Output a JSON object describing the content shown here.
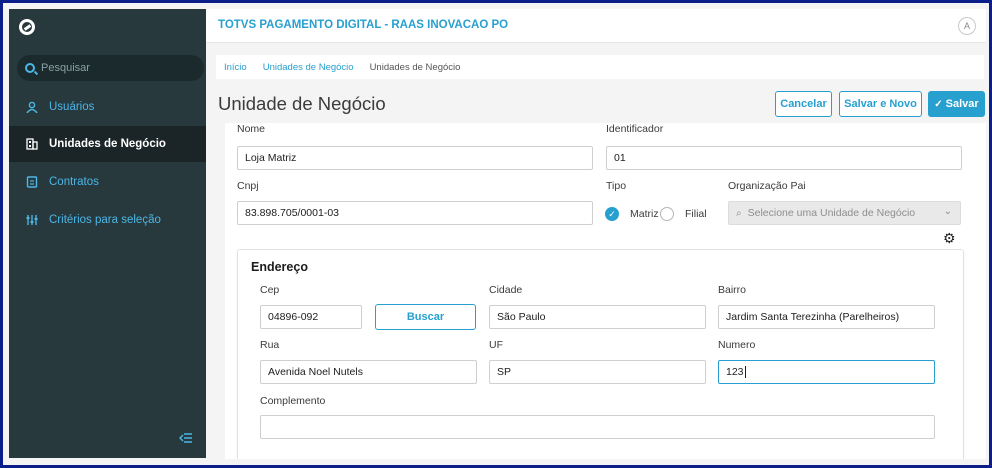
{
  "app": {
    "title": "TOTVS PAGAMENTO DIGITAL - RAAS INOVACAO PO",
    "avatar_letter": "A"
  },
  "sidebar": {
    "search_placeholder": "Pesquisar",
    "items": [
      {
        "label": "Usuários",
        "icon": "user-icon"
      },
      {
        "label": "Unidades de Negócio",
        "icon": "building-icon",
        "active": true
      },
      {
        "label": "Contratos",
        "icon": "contract-icon"
      },
      {
        "label": "Critérios para seleção",
        "icon": "sliders-icon"
      }
    ]
  },
  "breadcrumb": [
    "Início",
    "Unidades de Negócio",
    "Unidades de Negócio"
  ],
  "page": {
    "title": "Unidade de Negócio"
  },
  "actions": {
    "cancel": "Cancelar",
    "save_new": "Salvar e Novo",
    "save": "Salvar",
    "save_icon": "check-icon"
  },
  "form": {
    "nome": {
      "label": "Nome",
      "value": "Loja Matriz"
    },
    "identificador": {
      "label": "Identificador",
      "value": "01"
    },
    "cnpj": {
      "label": "Cnpj",
      "value": "83.898.705/0001-03"
    },
    "tipo": {
      "label": "Tipo",
      "options": [
        "Matriz",
        "Filial"
      ],
      "selected": "Matriz"
    },
    "organizacao_pai": {
      "label": "Organização Pai",
      "placeholder": "Selecione uma Unidade de Negócio"
    }
  },
  "endereco": {
    "title": "Endereço",
    "cep": {
      "label": "Cep",
      "value": "04896-092"
    },
    "buscar": "Buscar",
    "cidade": {
      "label": "Cidade",
      "value": "São Paulo"
    },
    "bairro": {
      "label": "Bairro",
      "value": "Jardim Santa Terezinha (Parelheiros)"
    },
    "rua": {
      "label": "Rua",
      "value": "Avenida Noel Nutels"
    },
    "uf": {
      "label": "UF",
      "value": "SP"
    },
    "numero": {
      "label": "Numero",
      "value": "123"
    },
    "complemento": {
      "label": "Complemento",
      "value": ""
    }
  },
  "colors": {
    "accent": "#27a0cf",
    "sidebar": "#27393d",
    "frame": "#0b1e8a"
  }
}
